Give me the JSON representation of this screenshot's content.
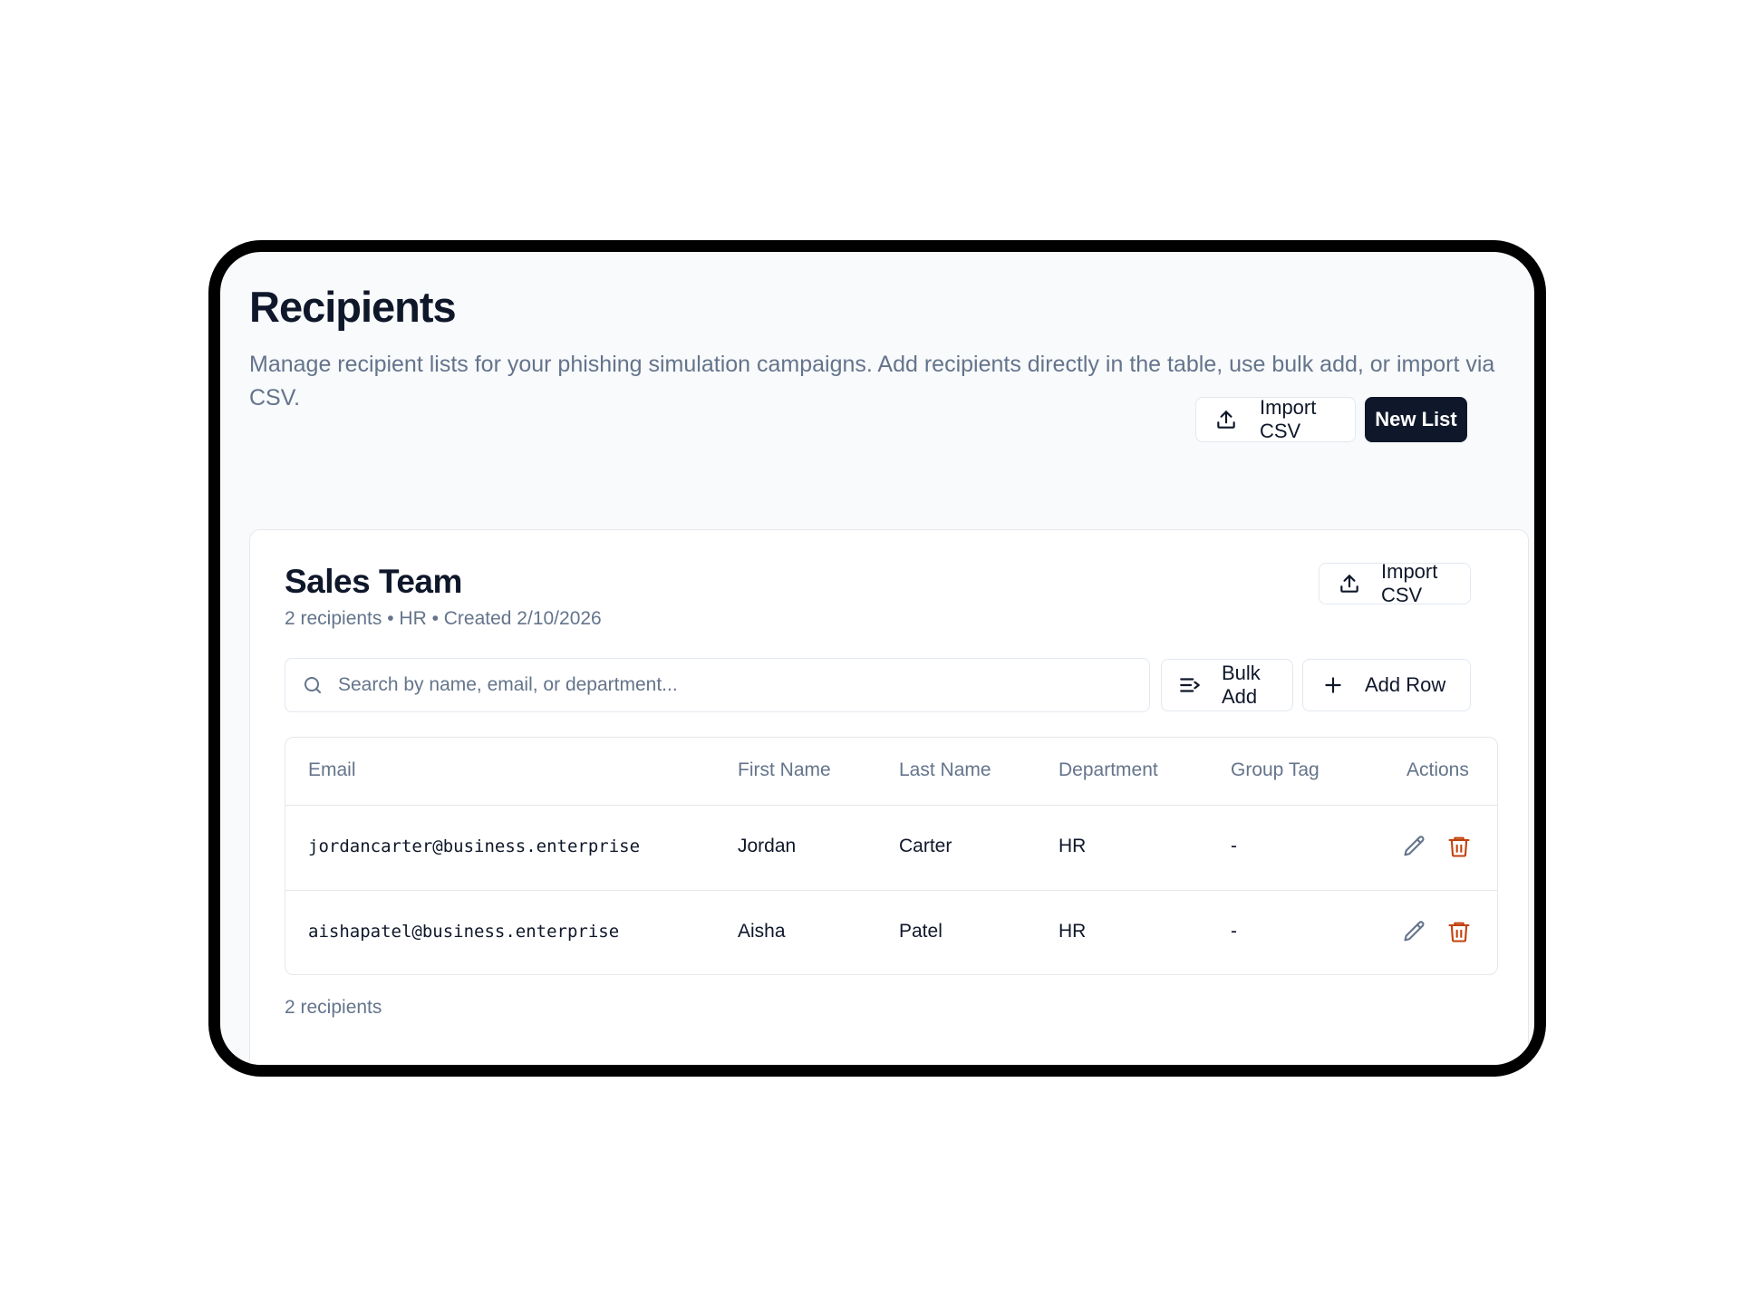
{
  "page": {
    "title": "Recipients",
    "description": "Manage recipient lists for your phishing simulation campaigns. Add recipients directly in the table, use bulk add, or import via CSV."
  },
  "toolbar": {
    "import_label": "Import CSV",
    "new_list_label": "New List"
  },
  "list": {
    "name": "Sales Team",
    "meta": "2 recipients • HR • Created 2/10/2026",
    "import_label": "Import CSV",
    "search_placeholder": "Search by name, email, or department...",
    "bulk_add_label": "Bulk Add",
    "add_row_label": "Add Row",
    "columns": [
      "Email",
      "First Name",
      "Last Name",
      "Department",
      "Group Tag",
      "Actions"
    ],
    "rows": [
      {
        "email": "jordancarter@business.enterprise",
        "first": "Jordan",
        "last": "Carter",
        "dept": "HR",
        "tag": "-"
      },
      {
        "email": "aishapatel@business.enterprise",
        "first": "Aisha",
        "last": "Patel",
        "dept": "HR",
        "tag": "-"
      }
    ],
    "footer": "2 recipients"
  },
  "icons": {
    "upload": "upload-icon",
    "search": "search-icon",
    "bulk": "list-add-icon",
    "plus": "plus-icon",
    "edit": "pencil-icon",
    "delete": "trash-icon"
  },
  "colors": {
    "primary": "#0f172a",
    "muted": "#64748b",
    "danger": "#c2410c"
  }
}
